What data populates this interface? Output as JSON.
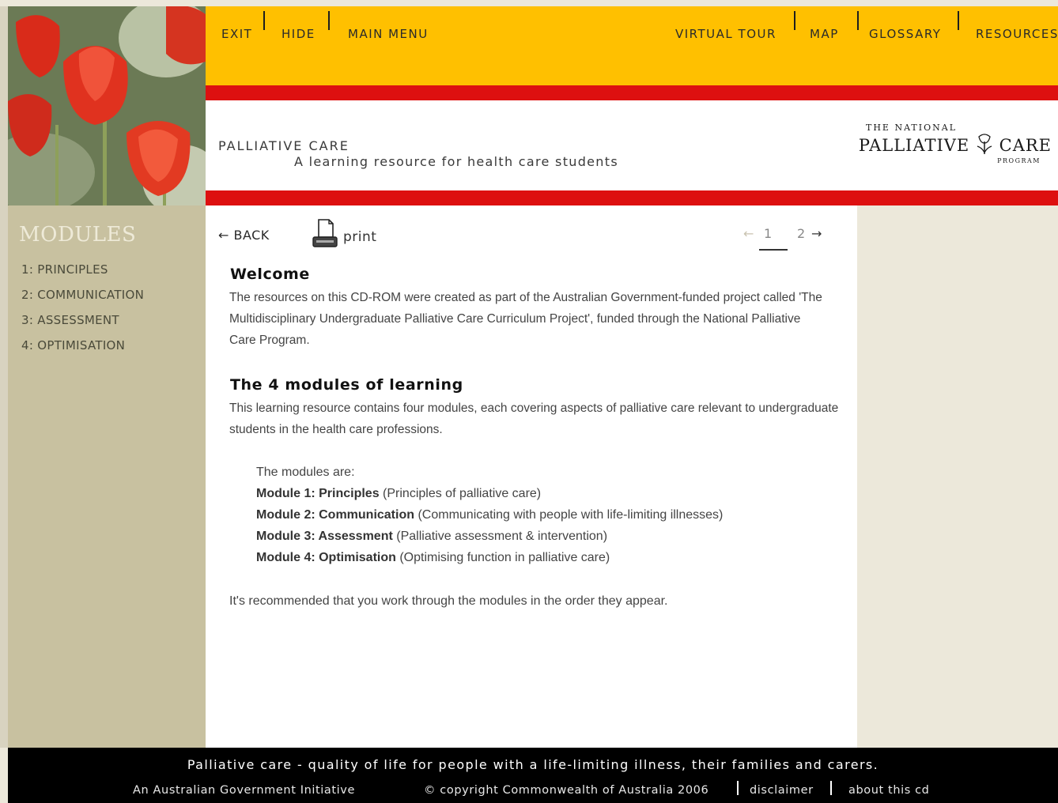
{
  "nav": {
    "exit": "EXIT",
    "hide": "HIDE",
    "main_menu": "MAIN MENU",
    "virtual_tour": "VIRTUAL TOUR",
    "map": "MAP",
    "glossary": "GLOSSARY",
    "resources": "RESOURCES"
  },
  "banner": {
    "title": "PALLIATIVE CARE",
    "subtitle": "A learning resource for health care students",
    "logo_top": "THE NATIONAL",
    "logo_main_left": "PALLIATIVE",
    "logo_main_right": "CARE",
    "logo_program": "PROGRAM"
  },
  "sidebar": {
    "title": "MODULES",
    "items": [
      {
        "label": "1: PRINCIPLES"
      },
      {
        "label": "2: COMMUNICATION"
      },
      {
        "label": "3: ASSESSMENT"
      },
      {
        "label": "4: OPTIMISATION"
      }
    ]
  },
  "toolbar": {
    "back_label": "← BACK",
    "print_label": "print"
  },
  "pager": {
    "prev": "←",
    "page1": "1",
    "page2": "2",
    "next": "→",
    "current": 1
  },
  "content": {
    "welcome_heading": "Welcome",
    "welcome_text": "The resources on this CD-ROM were created as part of the Australian Government-funded project called 'The Multidisciplinary Undergraduate Palliative Care Curriculum Project', funded through the National Palliative Care Program.",
    "modules_heading": "The 4 modules of learning",
    "modules_text": "This learning resource contains four modules, each covering aspects of palliative care relevant to undergraduate students in the health care professions.",
    "modules_intro": "The modules are:",
    "modules": [
      {
        "name": "Module 1: Principles",
        "desc": "(Principles of palliative care)"
      },
      {
        "name": "Module 2: Communication",
        "desc": "(Communicating with people with life-limiting illnesses)"
      },
      {
        "name": "Module 3: Assessment",
        "desc": "(Palliative assessment & intervention)"
      },
      {
        "name": "Module 4: Optimisation",
        "desc": "(Optimising function in palliative care)"
      }
    ],
    "recommendation": "It's recommended that you work through the modules in the order they appear."
  },
  "footer": {
    "tagline": "Palliative care - quality of life for people with a life-limiting illness, their families and carers.",
    "initiative": "An Australian Government Initiative",
    "copyright": "© copyright Commonwealth of Australia 2006",
    "disclaimer": "disclaimer",
    "about": "about this cd"
  },
  "colors": {
    "nav_bg": "#ffc000",
    "red_bar": "#dd1010",
    "sidebar_bg": "#c8c1a0",
    "right_pane": "#ece8da",
    "footer_bg": "#000000"
  }
}
